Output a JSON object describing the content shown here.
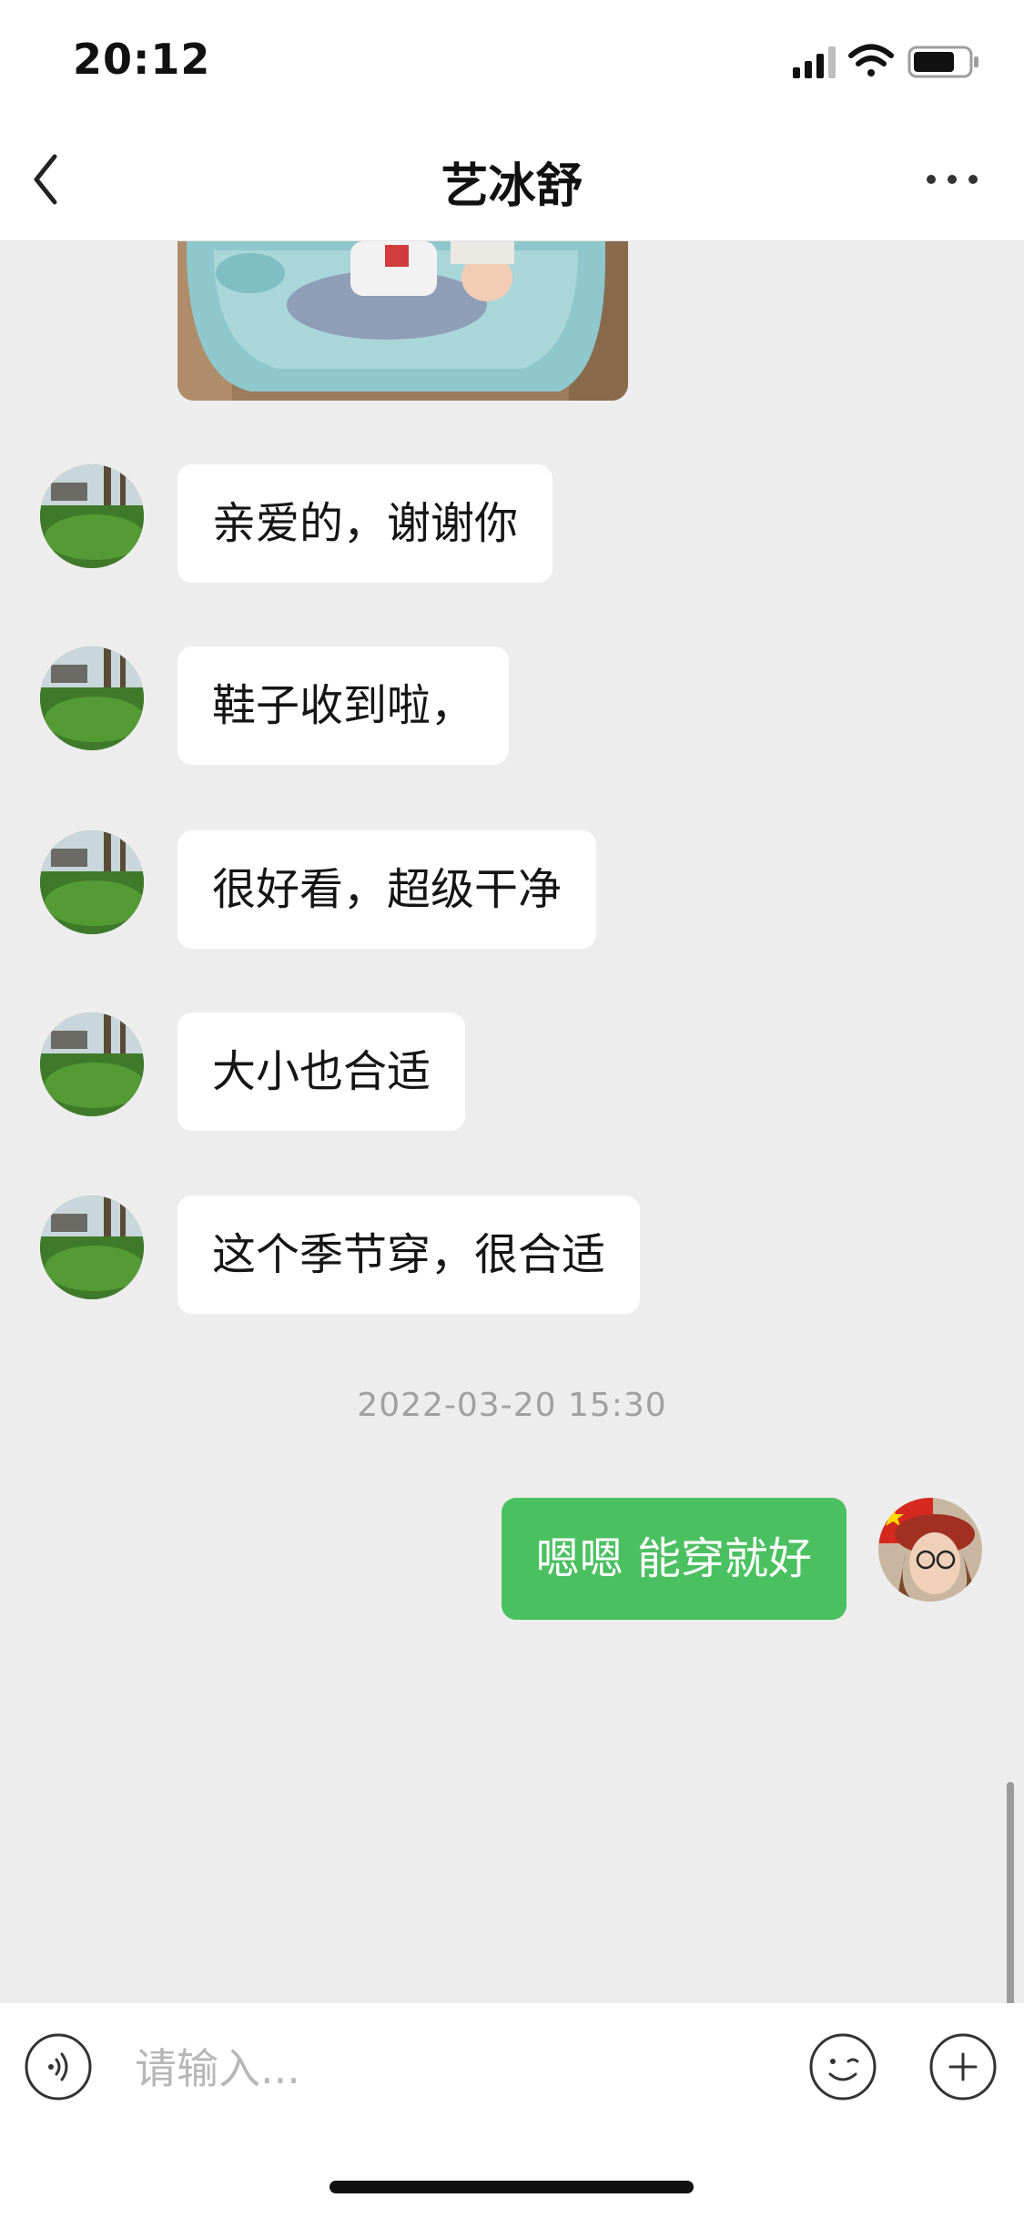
{
  "status_bar": {
    "time": "20:12",
    "icons": [
      "signal-icon",
      "wifi-icon",
      "battery-icon"
    ]
  },
  "nav": {
    "title": "艺冰舒",
    "back_icon": "chevron-left-icon",
    "more_icon": "more-dots-icon"
  },
  "messages": [
    {
      "type": "image",
      "side": "left"
    },
    {
      "type": "text",
      "side": "left",
      "text": "亲爱的，谢谢你"
    },
    {
      "type": "text",
      "side": "left",
      "text": "鞋子收到啦，"
    },
    {
      "type": "text",
      "side": "left",
      "text": "很好看，超级干净"
    },
    {
      "type": "text",
      "side": "left",
      "text": "大小也合适"
    },
    {
      "type": "text",
      "side": "left",
      "text": "这个季节穿，很合适"
    }
  ],
  "timestamp": "2022-03-20 15:30",
  "outgoing": {
    "text": "嗯嗯 能穿就好",
    "side": "right"
  },
  "input": {
    "placeholder": "请输入...",
    "value": "",
    "icons": [
      "voice-icon",
      "emoji-icon",
      "plus-icon"
    ]
  },
  "colors": {
    "background": "#ededed",
    "outgoing_bubble": "#4bc060",
    "incoming_bubble": "#ffffff"
  }
}
